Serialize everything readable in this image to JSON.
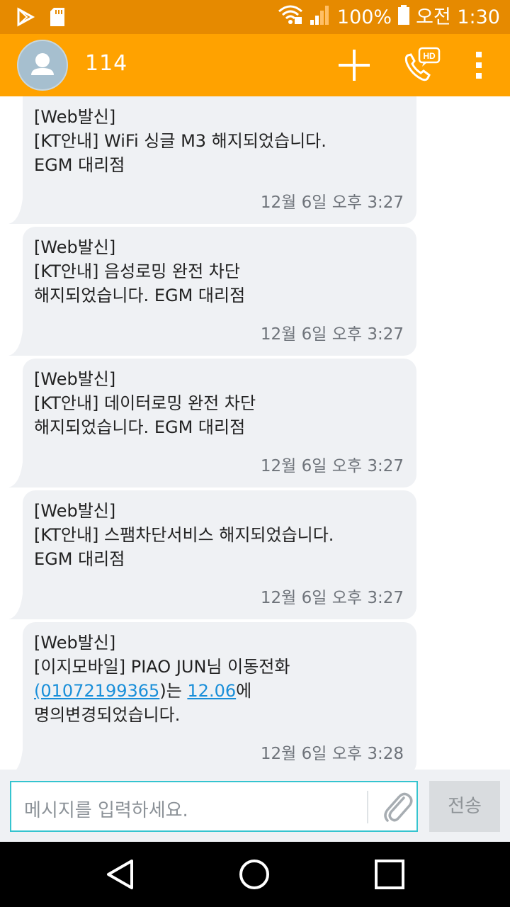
{
  "status_bar": {
    "battery": "100%",
    "time": "오전 1:30"
  },
  "app_bar": {
    "contact": "114"
  },
  "messages": [
    {
      "lines": [
        "[Web발신]",
        "[KT안내] WiFi 싱글 M3 해지되었습니다.",
        "EGM 대리점"
      ],
      "time": "12월 6일 오후 3:27"
    },
    {
      "lines": [
        "[Web발신]",
        "[KT안내] 음성로밍 완전 차단",
        "해지되었습니다. EGM 대리점"
      ],
      "time": "12월 6일 오후 3:27"
    },
    {
      "lines": [
        "[Web발신]",
        "[KT안내] 데이터로밍 완전 차단",
        "해지되었습니다. EGM 대리점"
      ],
      "time": "12월 6일 오후 3:27"
    },
    {
      "lines": [
        "[Web발신]",
        "[KT안내] 스팸차단서비스 해지되었습니다.",
        "EGM 대리점"
      ],
      "time": "12월 6일 오후 3:27"
    },
    {
      "line1": "[Web발신]",
      "line2": "[이지모바일] PIAO JUN님 이동전화",
      "phone_link": "(01072199365",
      "mid_text": ")는 ",
      "date_link": "12.06",
      "end_text": "에",
      "line4": "명의변경되었습니다.",
      "time": "12월 6일 오후 3:28"
    }
  ],
  "compose": {
    "placeholder": "메시지를 입력하세요.",
    "send_label": "전송"
  },
  "colors": {
    "status_bar": "#e68a00",
    "app_bar": "#ffa200",
    "bubble": "#eff1f4",
    "link": "#1a8fd9",
    "input_border": "#35c4cf"
  },
  "icons": [
    "play-store-icon",
    "sd-card-icon",
    "wifi-icon",
    "signal-icon",
    "battery-icon",
    "add-icon",
    "hd-call-icon",
    "more-icon",
    "attach-icon",
    "back-icon",
    "home-icon",
    "recents-icon"
  ]
}
